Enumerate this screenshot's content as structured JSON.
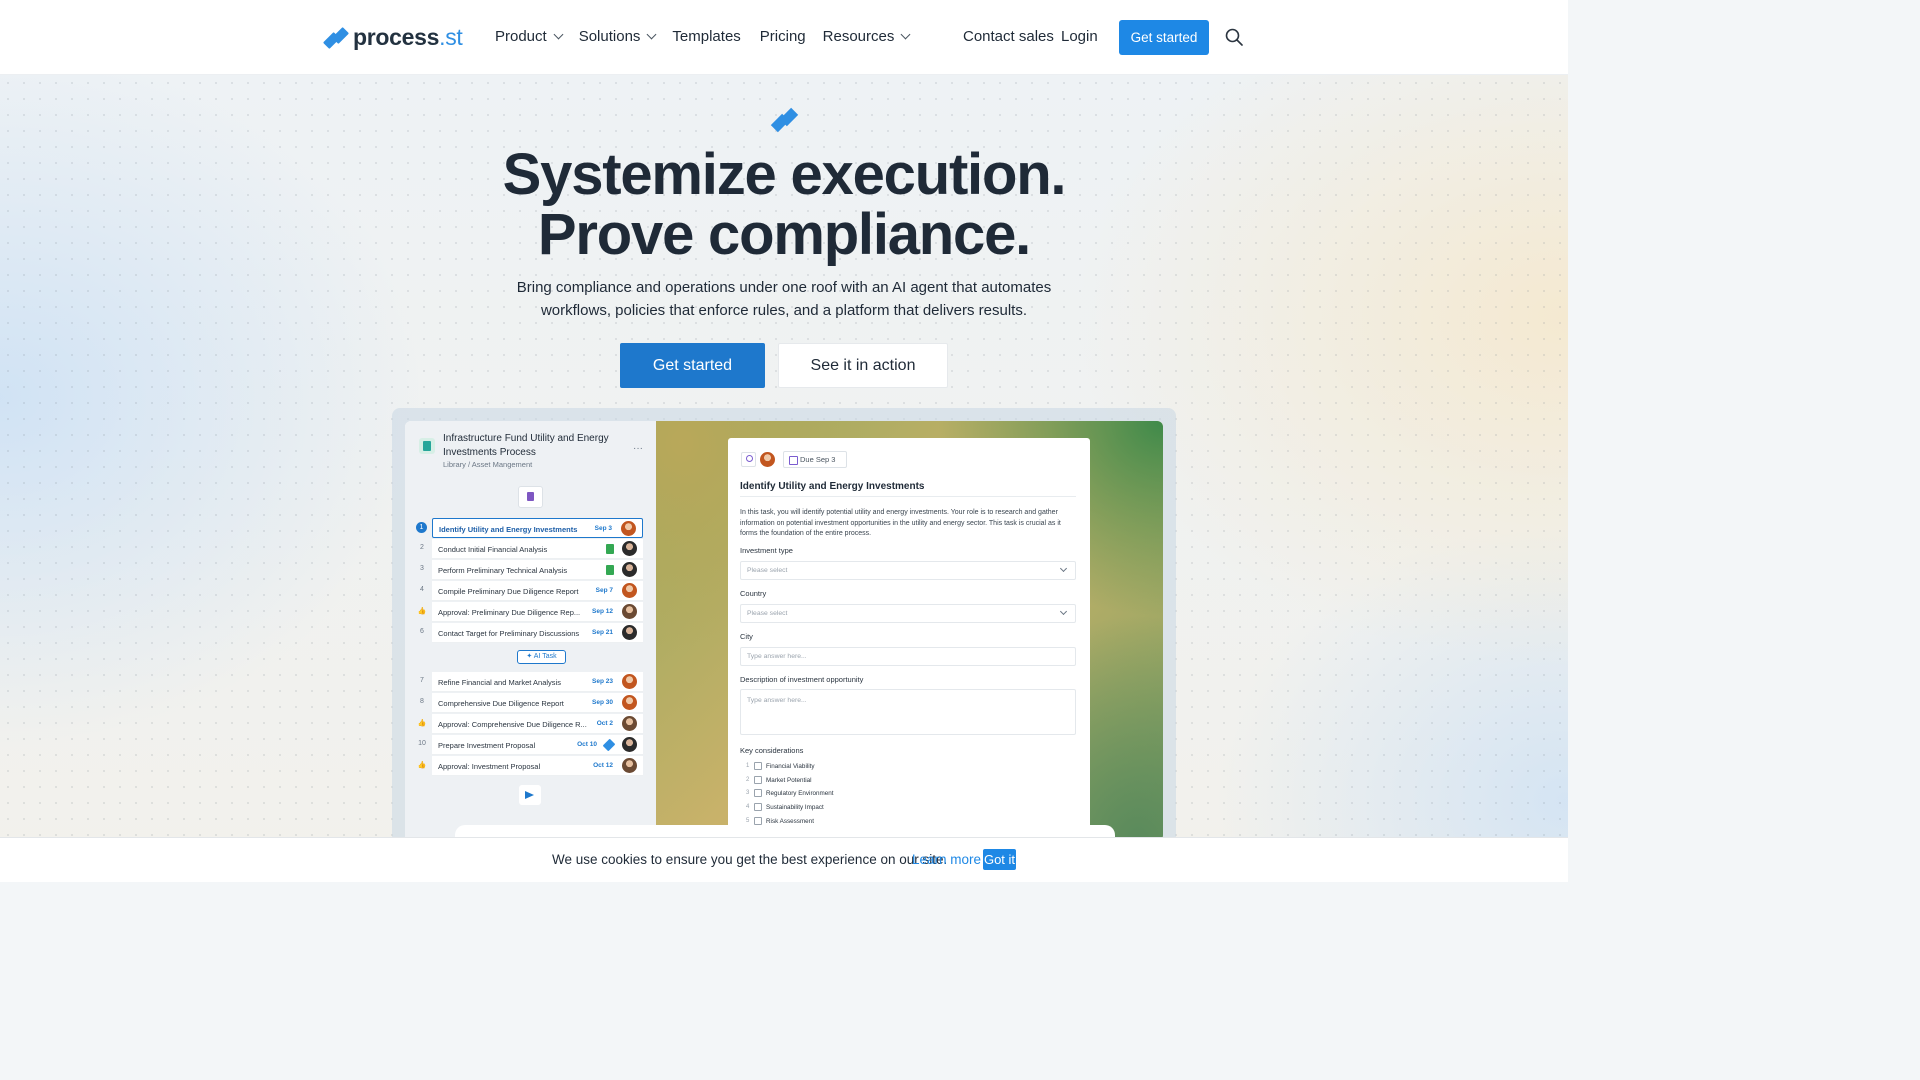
{
  "header": {
    "logo_text": "process",
    "logo_suffix": ".st",
    "nav": [
      {
        "label": "Product",
        "dropdown": true
      },
      {
        "label": "Solutions",
        "dropdown": true
      },
      {
        "label": "Templates",
        "dropdown": false
      },
      {
        "label": "Pricing",
        "dropdown": false
      },
      {
        "label": "Resources",
        "dropdown": true
      }
    ],
    "contact_sales": "Contact sales",
    "login": "Login",
    "get_started": "Get started"
  },
  "hero": {
    "headline_line1": "Systemize execution.",
    "headline_line2": "Prove compliance.",
    "subhead_line1": "Bring compliance and operations under one roof with an AI agent that automates",
    "subhead_line2": "workflows, policies that enforce rules, and a platform that delivers results.",
    "primary_cta": "Get started",
    "secondary_cta": "See it in action"
  },
  "app": {
    "process_title": "Infrastructure Fund Utility and Energy Investments Process",
    "breadcrumb": "Library / Asset Mangement",
    "more": "···",
    "tasks_group1": [
      {
        "num": "1",
        "name": "Identify Utility and Energy Investments",
        "date": "Sep 3",
        "active": true,
        "avatar": "a"
      },
      {
        "num": "2",
        "name": "Conduct Initial Financial Analysis",
        "date": "",
        "sheet": true,
        "avatar": "b"
      },
      {
        "num": "3",
        "name": "Perform Preliminary Technical Analysis",
        "date": "",
        "sheet": true,
        "avatar": "b"
      },
      {
        "num": "4",
        "name": "Compile Preliminary Due Diligence Report",
        "date": "Sep 7",
        "avatar": "a"
      },
      {
        "num": "👍",
        "name": "Approval: Preliminary Due Diligence Rep...",
        "date": "Sep 12",
        "avatar": "c"
      },
      {
        "num": "6",
        "name": "Contact Target for Preliminary Discussions",
        "date": "Sep 21",
        "avatar": "b"
      }
    ],
    "ai_task_label": "✦ AI Task",
    "tasks_group2": [
      {
        "num": "7",
        "name": "Refine Financial and Market Analysis",
        "date": "Sep 23",
        "avatar": "a"
      },
      {
        "num": "8",
        "name": "Comprehensive Due Diligence Report",
        "date": "Sep 30",
        "avatar": "a"
      },
      {
        "num": "👍",
        "name": "Approval: Comprehensive Due Diligence R...",
        "date": "Oct 2",
        "avatar": "c"
      },
      {
        "num": "10",
        "name": "Prepare Investment Proposal",
        "date": "Oct 10",
        "avatar": "b"
      },
      {
        "num": "👍",
        "name": "Approval: Investment Proposal",
        "date": "Oct 12",
        "avatar": "c"
      }
    ],
    "card": {
      "due": "Due Sep 3",
      "title": "Identify Utility and Energy Investments",
      "description": "In this task, you will identify potential utility and energy investments. Your role is to research and gather information on potential investment opportunities in the utility and energy sector. This task is crucial as it forms the foundation of the entire process.",
      "field_investment_type": "Investment type",
      "field_country": "Country",
      "select_placeholder": "Please select",
      "field_city": "City",
      "text_placeholder": "Type answer here...",
      "field_description": "Description of investment opportunity",
      "field_key_considerations": "Key considerations",
      "considerations": [
        {
          "num": "1",
          "label": "Financial Viability"
        },
        {
          "num": "2",
          "label": "Market Potential"
        },
        {
          "num": "3",
          "label": "Regulatory Environment"
        },
        {
          "num": "4",
          "label": "Sustainability Impact"
        },
        {
          "num": "5",
          "label": "Risk Assessment"
        }
      ]
    }
  },
  "cookie": {
    "text": "We use cookies to ensure you get the best experience on our site.",
    "link": "Learn more",
    "button": "Got it"
  },
  "colors": {
    "brand_blue": "#1e88e5",
    "cta_blue": "#1e78cc",
    "headline": "#1f2a37"
  }
}
